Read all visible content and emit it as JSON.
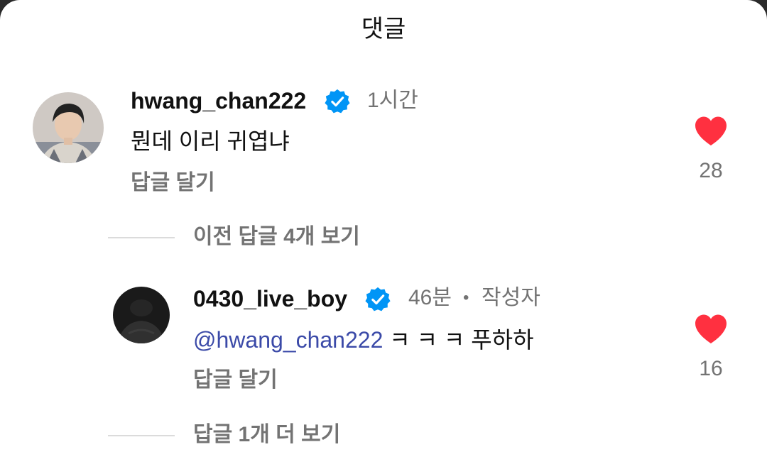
{
  "header": {
    "title": "댓글"
  },
  "comment": {
    "username": "hwang_chan222",
    "time": "1시간",
    "text": "뭔데 이리 귀엽냐",
    "reply_label": "답글 달기",
    "like_count": "28"
  },
  "view_previous_replies": "이전 답글 4개 보기",
  "reply": {
    "username": "0430_live_boy",
    "time": "46분",
    "separator": "•",
    "author_badge": "작성자",
    "mention": "@hwang_chan222",
    "text": "ㅋ ㅋ ㅋ 푸하하",
    "reply_label": "답글 달기",
    "like_count": "16"
  },
  "view_more_replies": "답글 1개 더 보기",
  "colors": {
    "heart": "#ff3040",
    "verified": "#0095f6",
    "mention": "#3b4aa8",
    "secondary_text": "#737373"
  }
}
